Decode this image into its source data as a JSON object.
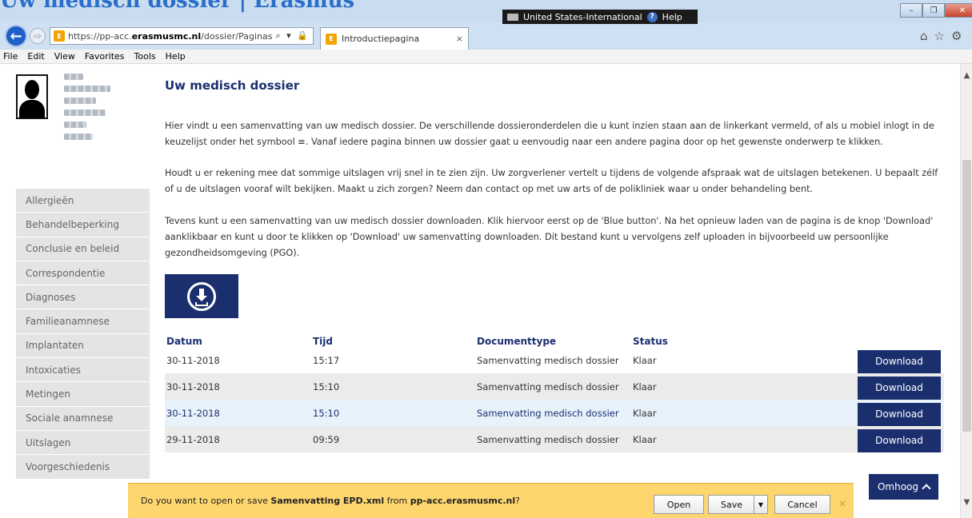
{
  "window": {
    "title_peek": "Uw medisch dossier | Erasmus",
    "language": "United States-International",
    "help": "Help",
    "min": "–",
    "max": "❐",
    "close": "✕"
  },
  "browser": {
    "url_prefix": "https://pp-acc.",
    "url_domain": "erasmusmc.nl",
    "url_path": "/dossier/Paginas",
    "address_icons": "⌕ ▾ 🔒 ↻",
    "tab_title": "Introductiepagina",
    "tab_close": "×",
    "toolbar_icons": [
      "⌂",
      "☆",
      "⚙"
    ]
  },
  "menu": [
    "File",
    "Edit",
    "View",
    "Favorites",
    "Tools",
    "Help"
  ],
  "sidebar": {
    "items": [
      "Allergieën",
      "Behandelbeperking",
      "Conclusie en beleid",
      "Correspondentie",
      "Diagnoses",
      "Familieanamnese",
      "Implantaten",
      "Intoxicaties",
      "Metingen",
      "Sociale anamnese",
      "Uitslagen",
      "Voorgeschiedenis"
    ]
  },
  "main": {
    "title": "Uw medisch dossier",
    "p1": "Hier vindt u een samenvatting van uw medisch dossier. De verschillende dossieronderdelen die u kunt inzien staan aan de linkerkant vermeld, of als u mobiel inlogt in de keuzelijst onder het symbool ≡. Vanaf iedere pagina binnen uw dossier gaat u eenvoudig naar een andere pagina door op het gewenste onderwerp te klikken.",
    "p2": "Houdt u er rekening mee dat sommige uitslagen vrij snel in te zien zijn. Uw zorgverlener vertelt u tijdens de volgende afspraak wat de uitslagen betekenen. U bepaalt zélf of u de uitslagen vooraf wilt bekijken. Maakt u zich zorgen? Neem dan contact op met uw arts of de polikliniek waar u onder behandeling bent.",
    "p3": "Tevens kunt u een samenvatting van uw medisch dossier downloaden. Klik hiervoor eerst op de 'Blue button'. Na het opnieuw laden van de pagina is de knop 'Download' aanklikbaar en kunt u door te klikken op 'Download' uw samenvatting downloaden. Dit bestand kunt u vervolgens zelf uploaden in bijvoorbeeld uw persoonlijke gezondheidsomgeving (PGO)."
  },
  "table": {
    "headers": [
      "Datum",
      "Tijd",
      "Documenttype",
      "Status"
    ],
    "rows": [
      {
        "date": "30-11-2018",
        "time": "15:17",
        "type": "Samenvatting medisch dossier",
        "status": "Klaar",
        "action": "Download"
      },
      {
        "date": "30-11-2018",
        "time": "15:10",
        "type": "Samenvatting medisch dossier",
        "status": "Klaar",
        "action": "Download"
      },
      {
        "date": "30-11-2018",
        "time": "15:10",
        "type": "Samenvatting medisch dossier",
        "status": "Klaar",
        "action": "Download"
      },
      {
        "date": "29-11-2018",
        "time": "09:59",
        "type": "Samenvatting medisch dossier",
        "status": "Klaar",
        "action": "Download"
      }
    ]
  },
  "top_button": "Omhoog",
  "notification": {
    "prefix": "Do you want to open or save ",
    "filename": "Samenvatting EPD.xml",
    "middle": " from ",
    "source": "pp-acc.erasmusmc.nl",
    "suffix": "?",
    "open": "Open",
    "save": "Save",
    "save_drop": "▼",
    "cancel": "Cancel",
    "close": "×"
  },
  "colors": {
    "brand_navy": "#1b2f6e",
    "notification_bg": "#fdd66e",
    "sidebar_bg": "#e4e4e4"
  }
}
